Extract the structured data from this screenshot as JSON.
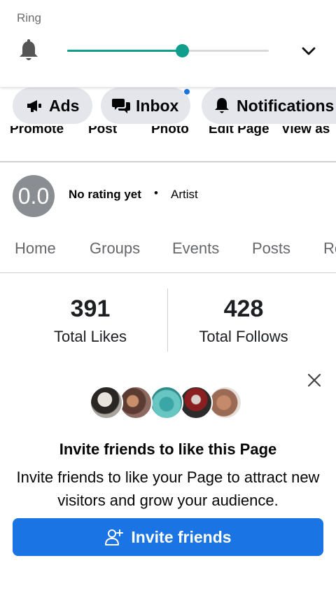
{
  "volume": {
    "label": "Ring",
    "level": 0.57,
    "accent_color": "#0e9e8b",
    "icon": "bell-icon",
    "expand_icon": "chevron-down-icon"
  },
  "actions": {
    "ads_label": "Ads",
    "inbox_label": "Inbox",
    "notifications_label": "Notifications",
    "inbox_unread_indicator_color": "#1b74e4"
  },
  "clipped_labels": [
    "Promote",
    "Post",
    "Photo",
    "Edit Page",
    "View as"
  ],
  "rating": {
    "score": "0.0",
    "text": "No rating yet",
    "separator": "•",
    "category": "Artist"
  },
  "tabs": [
    {
      "label": "Home"
    },
    {
      "label": "Groups"
    },
    {
      "label": "Events"
    },
    {
      "label": "Posts"
    },
    {
      "label": "Re"
    }
  ],
  "stats": {
    "likes_count": "391",
    "likes_label": "Total Likes",
    "follows_count": "428",
    "follows_label": "Total Follows"
  },
  "invite": {
    "title": "Invite friends to like this Page",
    "description": "Invite friends to like your Page to attract new visitors and grow your audience.",
    "button_label": "Invite friends",
    "close_icon": "close-icon",
    "button_color": "#1b74e4"
  }
}
